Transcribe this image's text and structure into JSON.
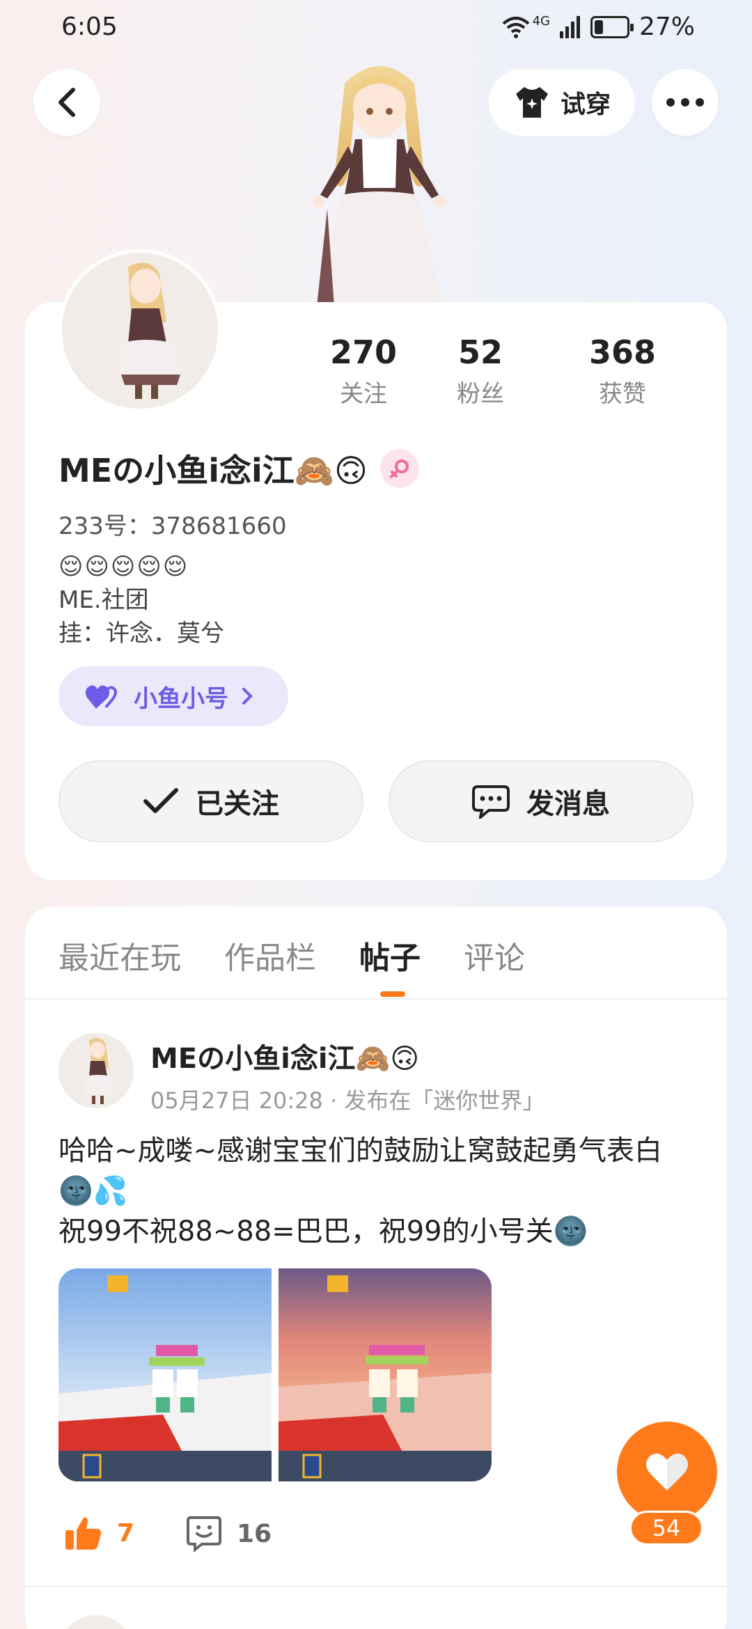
{
  "status_bar": {
    "time": "6:05",
    "network": "4G",
    "battery_level": 0.27,
    "battery_percent": "27%"
  },
  "header": {
    "try_on_label": "试穿",
    "back_icon": "chevron-left-icon",
    "more_icon": "ellipsis-icon"
  },
  "profile": {
    "stats": [
      {
        "value": "270",
        "label": "关注"
      },
      {
        "value": "52",
        "label": "粉丝"
      },
      {
        "value": "368",
        "label": "获赞"
      }
    ],
    "nickname": "MEの小鱼i念i江🙈🙃",
    "id_line": "233号：378681660",
    "bio_emoji": "😌😌😌😌😌",
    "bio_line1": "ME.社团",
    "bio_line2": "挂：许念．莫兮",
    "alt_account_label": "小鱼小号",
    "follow_label": "已关注",
    "message_label": "发消息"
  },
  "tabs": {
    "items": [
      "最近在玩",
      "作品栏",
      "帖子",
      "评论"
    ],
    "active_index": 2
  },
  "post": {
    "author": "MEの小鱼i念i江🙈🙃",
    "meta": "05月27日 20:28 · 发布在「迷你世界」",
    "text_line1": "哈哈~成喽~感谢宝宝们的鼓励让窝鼓起勇气表白",
    "text_line2": "🌚💦",
    "text_line3": "祝99不祝88~88=巴巴，祝99的小号关🌚",
    "like_count": "7",
    "comment_count": "16"
  },
  "fab": {
    "count": "54"
  },
  "colors": {
    "accent": "#ff7a1a",
    "alt_account_bg": "#ebe8fb",
    "alt_account_text": "#6c5ce7"
  }
}
